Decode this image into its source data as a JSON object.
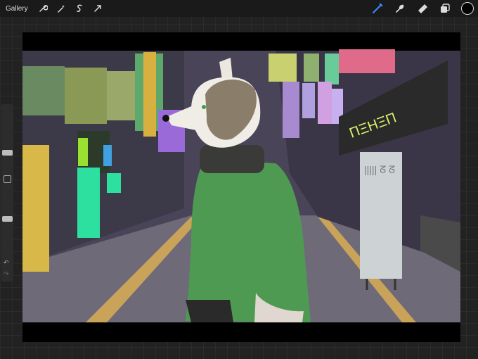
{
  "topbar": {
    "gallery_label": "Gallery",
    "left_tools": [
      "wrench-icon",
      "magic-wand-icon",
      "selection-icon",
      "transform-arrow-icon"
    ],
    "right_tools": [
      "brush-icon",
      "smudge-icon",
      "eraser-icon",
      "layers-icon"
    ]
  },
  "colors": {
    "active_tool": "#3d8cff",
    "current_color": "#000000"
  },
  "sidebar": {
    "brush_size_level": 0.3,
    "opacity_level": 0.55
  },
  "canvas_art": {
    "signage": {
      "right_sign": "ΠΞΗΞΠ",
      "standing_sign": "||||| ᘔ ᘔ"
    }
  }
}
